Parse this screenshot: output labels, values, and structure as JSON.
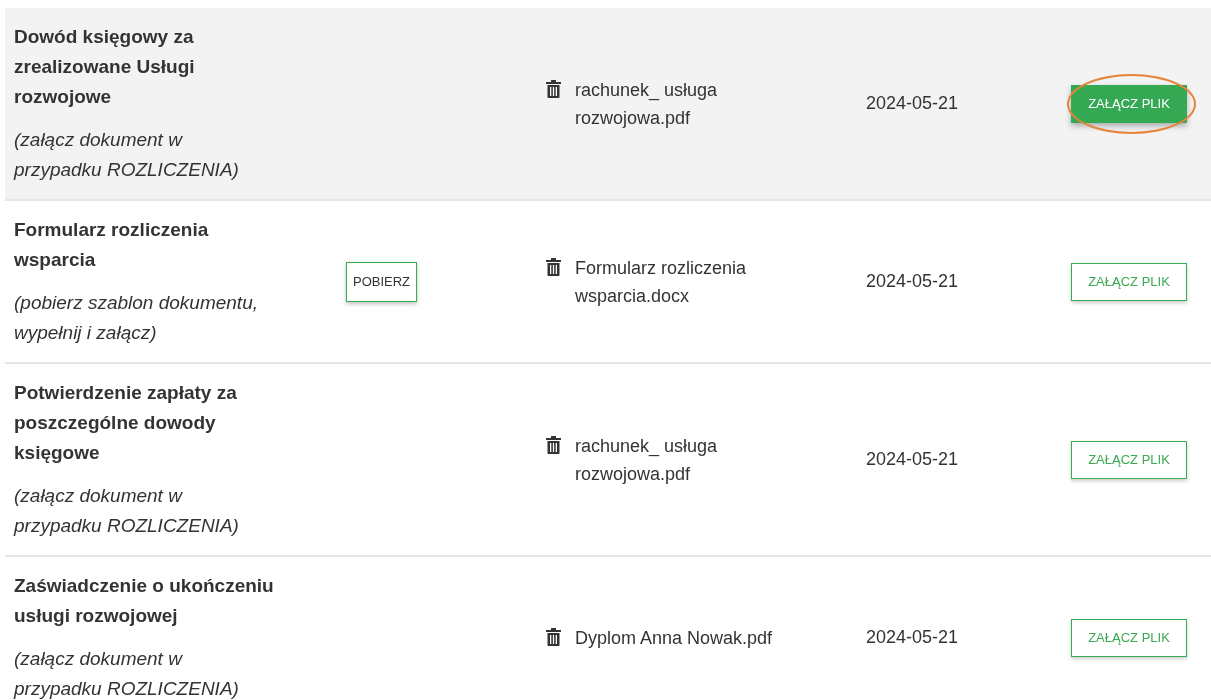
{
  "rows": [
    {
      "title": "Dowód księgowy za zrealizowane Usługi rozwojowe",
      "note": "(załącz dokument w przypadku ROZLICZENIA)",
      "file": "rachunek_ usługa rozwojowa.pdf",
      "date": "2024-05-21",
      "attach": {
        "label": "ZAŁĄCZ PLIK",
        "filled": true,
        "circled": true
      },
      "highlighted": true
    },
    {
      "title": "Formularz rozliczenia wsparcia",
      "note": "(pobierz szablon dokumentu, wypełnij i załącz)",
      "download": "POBIERZ",
      "file": "Formularz rozliczenia wsparcia.docx",
      "date": "2024-05-21",
      "attach": {
        "label": "ZAŁĄCZ PLIK",
        "filled": false,
        "circled": false
      },
      "highlighted": false
    },
    {
      "title": "Potwierdzenie zapłaty za poszczególne dowody księgowe",
      "note": "(załącz dokument w przypadku ROZLICZENIA)",
      "file": "rachunek_ usługa rozwojowa.pdf",
      "date": "2024-05-21",
      "attach": {
        "label": "ZAŁĄCZ PLIK",
        "filled": false,
        "circled": false
      },
      "highlighted": false
    },
    {
      "title": "Zaświadczenie o ukończeniu usługi rozwojowej",
      "note": "(załącz dokument w przypadku ROZLICZENIA)",
      "file": "Dyplom Anna Nowak.pdf",
      "date": "2024-05-21",
      "attach": {
        "label": "ZAŁĄCZ PLIK",
        "filled": false,
        "circled": false
      },
      "highlighted": false
    }
  ]
}
